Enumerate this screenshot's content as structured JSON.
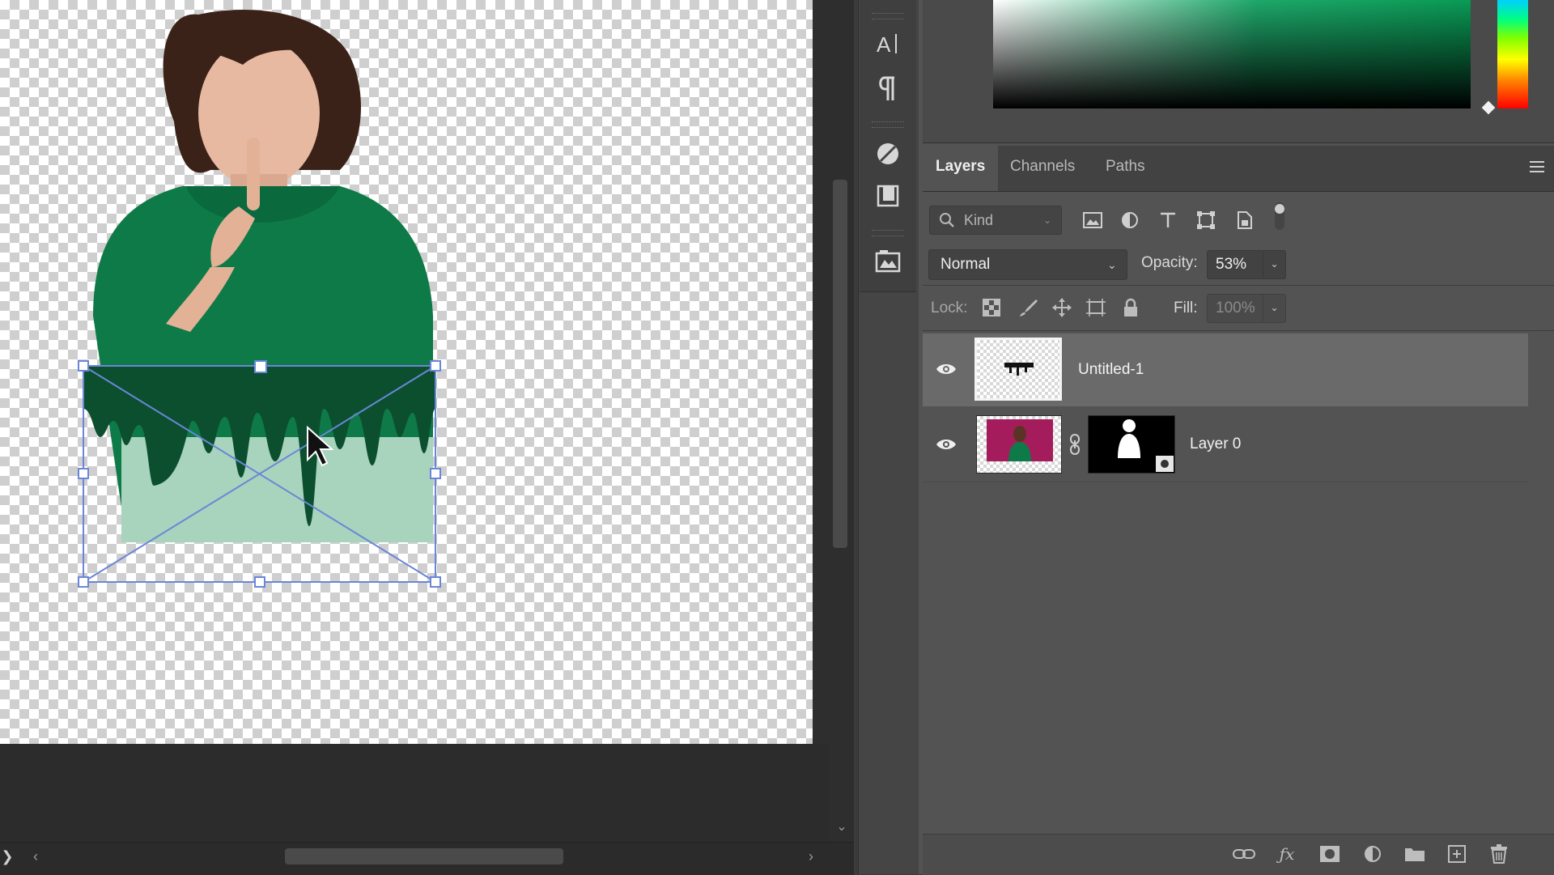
{
  "layers_panel": {
    "tabs": [
      "Layers",
      "Channels",
      "Paths"
    ],
    "active_tab": "Layers",
    "filter": {
      "placeholder": "Kind"
    },
    "blend_mode": "Normal",
    "opacity_label": "Opacity:",
    "opacity_value": "53%",
    "lock_label": "Lock:",
    "fill_label": "Fill:",
    "fill_value": "100%",
    "layers": [
      {
        "name": "Untitled-1",
        "visible": true,
        "selected": true
      },
      {
        "name": "Layer 0",
        "visible": true,
        "selected": false,
        "has_mask": true
      }
    ]
  },
  "icons": {
    "tool_strip": [
      "character-icon",
      "paragraph-icon",
      "adjustments-icon",
      "libraries-icon",
      "image-panel-icon"
    ],
    "filters": [
      "image-filter-icon",
      "adjustment-filter-icon",
      "type-filter-icon",
      "shape-filter-icon",
      "smart-object-filter-icon",
      "filter-toggle-icon"
    ],
    "locks": [
      "lock-transparent-icon",
      "lock-pixels-icon",
      "lock-position-icon",
      "lock-artboard-icon",
      "lock-all-icon"
    ],
    "footer": [
      "link-layers-icon",
      "fx-icon",
      "add-mask-icon",
      "new-adjustment-icon",
      "new-group-icon",
      "new-layer-icon",
      "delete-layer-icon"
    ]
  },
  "colors": {
    "accent_selection": "#6b86d8",
    "hoodie_green": "#0e7a47",
    "panel_bg": "#535353",
    "selected_layer_bg": "#6a6a6a"
  }
}
